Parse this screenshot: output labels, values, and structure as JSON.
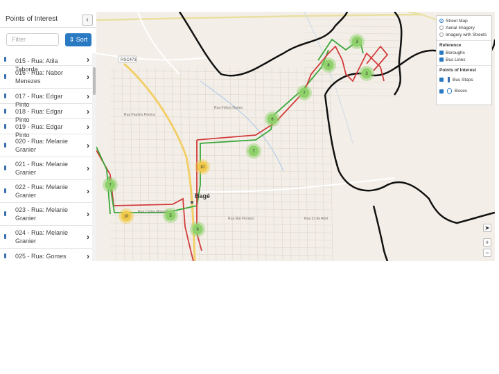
{
  "sidebar": {
    "title": "Points of Interest",
    "collapse_icon": "‹",
    "filter_placeholder": "Filter",
    "sort_label": "⇕ Sort",
    "items": [
      {
        "label": "015 - Rua: Atila Taborda"
      },
      {
        "label": "016 - Rua: Nabor Menezes"
      },
      {
        "label": "017 - Rua: Edgar Pinto"
      },
      {
        "label": "018 - Rua: Edgar Pinto"
      },
      {
        "label": "019 - Rua: Edgar Pinto"
      },
      {
        "label": "020 - Rua: Melanie Granier"
      },
      {
        "label": "021 - Rua: Melanie Granier"
      },
      {
        "label": "022 - Rua: Melanie Granier"
      },
      {
        "label": "023 - Rua: Melanie Granier"
      },
      {
        "label": "024 - Rua: Melanie Granier"
      },
      {
        "label": "025 - Rua: Gomes"
      }
    ]
  },
  "layers": {
    "basemaps": [
      "Street Map",
      "Aerial Imagery",
      "Imagery with Streets"
    ],
    "selected_basemap": "Street Map",
    "reference_heading": "Reference",
    "reference": [
      "Boroughs",
      "Bus Lines"
    ],
    "poi_heading": "Points of Interest",
    "poi": [
      "Bus Stops",
      "Buses"
    ]
  },
  "map": {
    "city_label": "Bagé",
    "road_label": "RSC473",
    "clusters": [
      "3",
      "8",
      "3",
      "7",
      "6",
      "7",
      "10",
      "7",
      "10",
      "5",
      "9"
    ],
    "colors": {
      "route_green": "#3aa63a",
      "route_red": "#d23b3b",
      "borough": "#111111",
      "cluster_green": "#8fd16a",
      "cluster_yellow": "#f1c94a"
    }
  },
  "controls": {
    "locate_icon": "➤",
    "zoom_in": "+",
    "zoom_out": "−"
  }
}
